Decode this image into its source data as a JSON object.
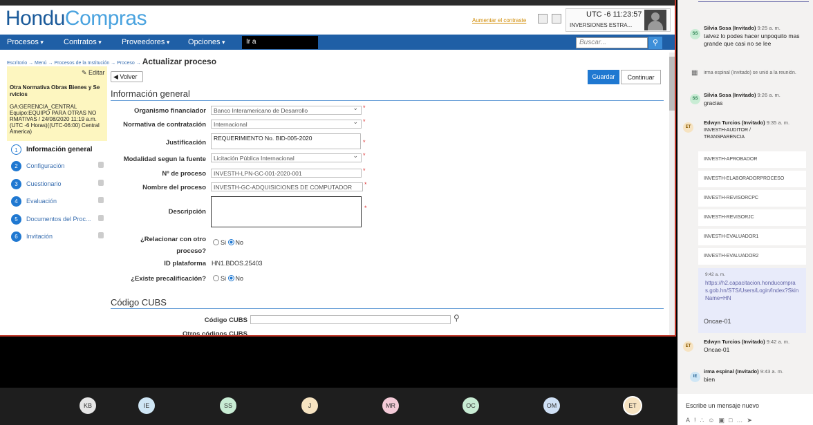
{
  "header": {
    "logo_a": "Hondu",
    "logo_b": "Compras",
    "aumentar": "Aumentar el contraste",
    "time": "UTC -6 11:23:57",
    "institution": "INVERSIONES ESTRA..."
  },
  "nav": {
    "items": [
      "Procesos",
      "Contratos",
      "Proveedores",
      "Opciones"
    ],
    "ira": "Ir a",
    "search_placeholder": "Buscar..."
  },
  "breadcrumb": {
    "path": "Escritorio → Menú → Procesos de la Institución → Proceso → ",
    "current": "Actualizar proceso"
  },
  "sidebar": {
    "editar": "Editar",
    "title": "Otra Normativa Obras Bienes y Se rvicios",
    "meta": "GA:GERENCIA_CENTRAL Equipo:EQUIPO PARA OTRAS NO RMATIVAS / 24/08/2020 11:19 a.m. (UTC -6 Horas)((UTC-06:00) Central America)",
    "steps": [
      {
        "n": "1",
        "label": "Información general"
      },
      {
        "n": "2",
        "label": "Configuración"
      },
      {
        "n": "3",
        "label": "Cuestionario"
      },
      {
        "n": "4",
        "label": "Evaluación"
      },
      {
        "n": "5",
        "label": "Documentos del Proc..."
      },
      {
        "n": "6",
        "label": "Invitación"
      }
    ]
  },
  "toolbar": {
    "volver": "Volver",
    "guardar": "Guardar",
    "continuar": "Continuar"
  },
  "form": {
    "section_general": "Información general",
    "labels": {
      "organismo": "Organismo financiador",
      "normativa": "Normativa de contratación",
      "justificacion": "Justificación",
      "modalidad": "Modalidad segun la fuente",
      "nproceso": "Nº de proceso",
      "nombre": "Nombre del proceso",
      "descripcion": "Descripción",
      "relacionar": "¿Relacionar con otro proceso?",
      "idplat": "ID plataforma",
      "precal": "¿Existe precalificación?"
    },
    "values": {
      "organismo": "Banco Interamericano de Desarrollo",
      "normativa": "Internacional",
      "justificacion": "REQUERIMIENTO No. BID-005-2020",
      "modalidad": "Licitación Pública Internacional",
      "nproceso": "INVESTH-LPN-GC-001-2020-001",
      "nombre": "INVESTH-GC-ADQUISICIONES DE COMPUTADOR",
      "idplat": "HN1.BDOS.25403"
    },
    "radio_si": "Si",
    "radio_no": "No",
    "section_cubs": "Código CUBS",
    "cubs_label": "Código CUBS",
    "otros": "Otros códigos CUBS"
  },
  "participants": [
    "KB",
    "IE",
    "SS",
    "J",
    "MR",
    "OC",
    "OM",
    "ET"
  ],
  "chat": {
    "m1_name": "Silvia Sosa (Invitado)",
    "m1_time": "9:25 a. m.",
    "m1_text": "talvez lo podes hacer unpoquito mas grande que casi no se lee",
    "sys": "irma espinal (Invitado) se unió a la reunión.",
    "m2_name": "Silvia Sosa (Invitado)",
    "m2_time": "9:26 a. m.",
    "m2_text": "gracias",
    "m3_name": "Edwyn Turcios (Invitado)",
    "m3_time": "9:35 a. m.",
    "m3_text": "INVESTH-AUDITOR / TRANSPARENCIA",
    "boxes": [
      "INVESTH-APROBADOR",
      "INVESTH-ELABORADORPROCESO",
      "INVESTH-REVISORCPC",
      "INVESTH-REVISORJC",
      "INVESTH-EVALUADOR1",
      "INVESTH-EVALUADOR2"
    ],
    "self_time": "9:42 a. m.",
    "self_link": "https://h2.capacitacion.honducompras.gob.hn/STS/Users/Login/Index?SkinName=HN",
    "self_msg2": "Oncae-01",
    "m4_name": "Edwyn Turcios (Invitado)",
    "m4_time": "9:42 a. m.",
    "m4_text": "Oncae-01",
    "m5_name": "irma espinal (Invitado)",
    "m5_time": "9:43 a. m.",
    "m5_text": "bien",
    "input_placeholder": "Escribe un mensaje nuevo"
  }
}
